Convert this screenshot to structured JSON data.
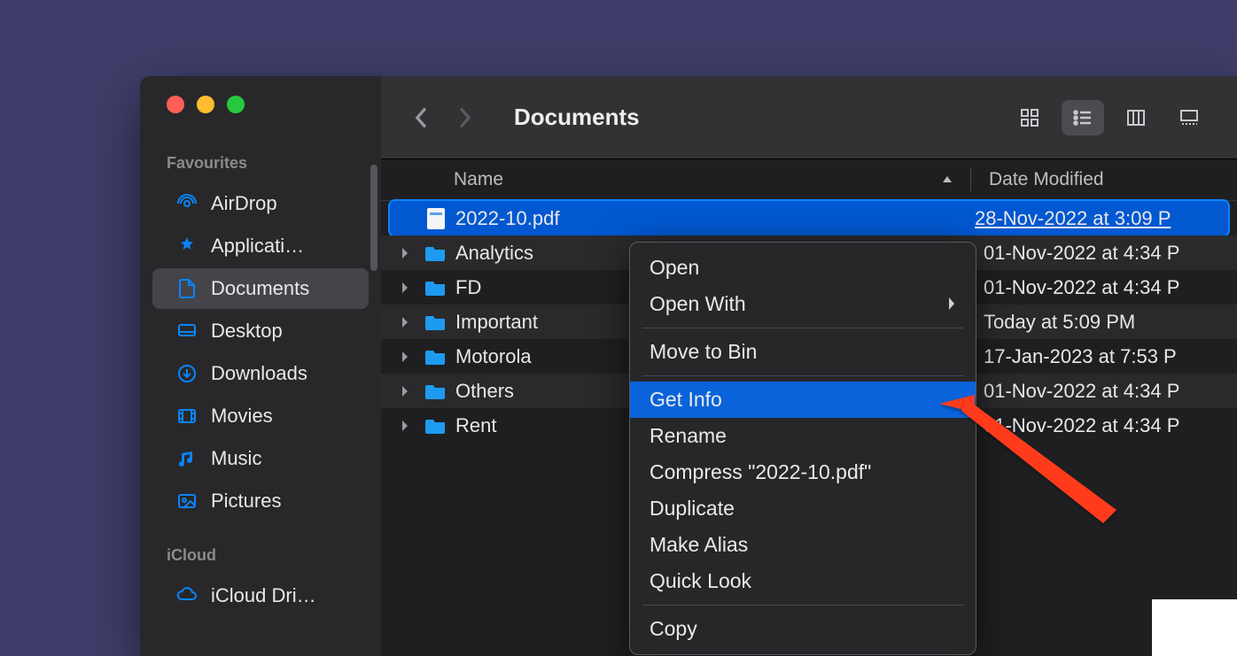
{
  "window": {
    "title": "Documents"
  },
  "sidebar": {
    "sections": [
      {
        "header": "Favourites",
        "items": [
          {
            "label": "AirDrop",
            "icon": "airdrop"
          },
          {
            "label": "Applicati…",
            "icon": "applications"
          },
          {
            "label": "Documents",
            "icon": "documents",
            "active": true
          },
          {
            "label": "Desktop",
            "icon": "desktop"
          },
          {
            "label": "Downloads",
            "icon": "downloads"
          },
          {
            "label": "Movies",
            "icon": "movies"
          },
          {
            "label": "Music",
            "icon": "music"
          },
          {
            "label": "Pictures",
            "icon": "pictures"
          }
        ]
      },
      {
        "header": "iCloud",
        "items": [
          {
            "label": "iCloud Dri…",
            "icon": "icloud"
          }
        ]
      }
    ]
  },
  "columns": {
    "name": "Name",
    "date": "Date Modified"
  },
  "rows": [
    {
      "type": "file",
      "name": "2022-10.pdf",
      "date": "28-Nov-2022 at 3:09 P",
      "selected": true
    },
    {
      "type": "folder",
      "name": "Analytics",
      "date": "01-Nov-2022 at 4:34 P"
    },
    {
      "type": "folder",
      "name": "FD",
      "date": "01-Nov-2022 at 4:34 P"
    },
    {
      "type": "folder",
      "name": "Important",
      "date": "Today at 5:09 PM"
    },
    {
      "type": "folder",
      "name": "Motorola",
      "date": "17-Jan-2023 at 7:53 P"
    },
    {
      "type": "folder",
      "name": "Others",
      "date": "01-Nov-2022 at 4:34 P"
    },
    {
      "type": "folder",
      "name": "Rent",
      "date": "01-Nov-2022 at 4:34 P"
    }
  ],
  "context_menu": {
    "items": [
      {
        "label": "Open"
      },
      {
        "label": "Open With",
        "submenu": true
      },
      {
        "sep": true
      },
      {
        "label": "Move to Bin"
      },
      {
        "sep": true
      },
      {
        "label": "Get Info",
        "highlighted": true
      },
      {
        "label": "Rename"
      },
      {
        "label": "Compress \"2022-10.pdf\""
      },
      {
        "label": "Duplicate"
      },
      {
        "label": "Make Alias"
      },
      {
        "label": "Quick Look"
      },
      {
        "sep": true
      },
      {
        "label": "Copy"
      }
    ]
  }
}
